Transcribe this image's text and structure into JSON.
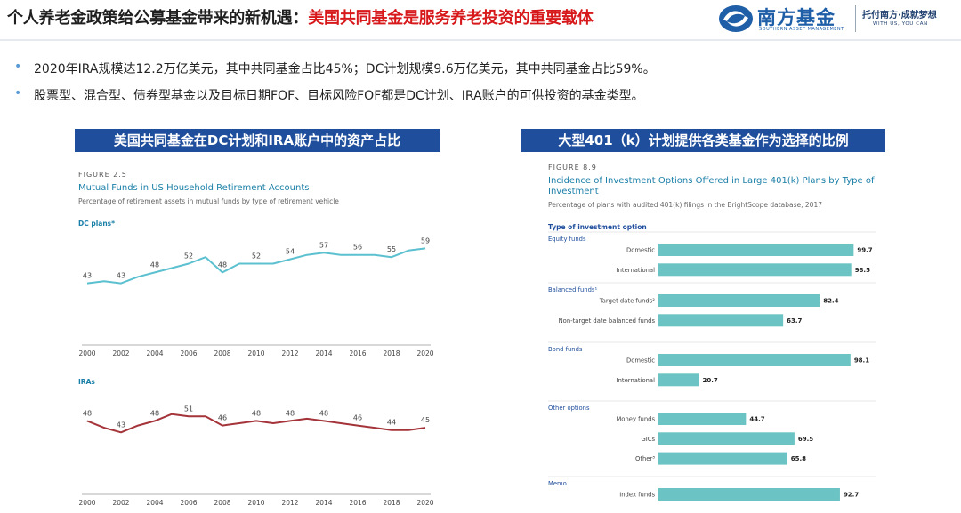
{
  "header": {
    "title_main": "个人养老金政策给公募基金带来的新机遇：",
    "title_highlight": "美国共同基金是服务养老投资的重要载体",
    "logo_cn": "南方基金",
    "logo_en": "SOUTHERN ASSET MANAGEMENT",
    "slogan_cn": "托付南方·成就梦想",
    "slogan_en": "WITH US, YOU CAN"
  },
  "bullets": [
    "2020年IRA规模达12.2万亿美元，其中共同基金占比45%；DC计划规模9.6万亿美元，其中共同基金占比59%。",
    "股票型、混合型、债券型基金以及目标日期FOF、目标风险FOF都是DC计划、IRA账户的可供投资的基金类型。"
  ],
  "colors": {
    "title_highlight": "#d7191c",
    "section_bar": "#1f4e9c",
    "dc_line": "#5bc0cf",
    "ira_line": "#a4343a",
    "bar_fill": "#6cc3c3",
    "figure_title": "#1a7fa8"
  },
  "left_section": {
    "heading": "美国共同基金在DC计划和IRA账户中的资产占比",
    "figure_label": "FIGURE 2.5",
    "figure_title": "Mutual Funds in US Household Retirement Accounts",
    "figure_subtitle": "Percentage of retirement assets in mutual funds by type of retirement vehicle"
  },
  "right_section": {
    "heading": "大型401（k）计划提供各类基金作为选择的比例",
    "figure_label": "FIGURE 8.9",
    "figure_title": "Incidence of Investment Options Offered in Large 401(k) Plans by Type of Investment",
    "figure_subtitle": "Percentage of plans with audited 401(k) filings in the BrightScope database, 2017",
    "type_header": "Type of investment option"
  },
  "chart_data": [
    {
      "type": "line",
      "title": "DC plans*",
      "x": [
        2000,
        2001,
        2002,
        2003,
        2004,
        2005,
        2006,
        2007,
        2008,
        2009,
        2010,
        2011,
        2012,
        2013,
        2014,
        2015,
        2016,
        2017,
        2018,
        2019,
        2020
      ],
      "values": [
        43,
        44,
        43,
        46,
        48,
        50,
        52,
        55,
        48,
        52,
        52,
        52,
        54,
        56,
        57,
        56,
        56,
        56,
        55,
        58,
        59
      ],
      "data_labels": [
        {
          "x": 2000,
          "label": "43"
        },
        {
          "x": 2002,
          "label": "43"
        },
        {
          "x": 2004,
          "label": "48"
        },
        {
          "x": 2006,
          "label": "52"
        },
        {
          "x": 2008,
          "label": "48"
        },
        {
          "x": 2010,
          "label": "52"
        },
        {
          "x": 2012,
          "label": "54"
        },
        {
          "x": 2014,
          "label": "57"
        },
        {
          "x": 2016,
          "label": "56"
        },
        {
          "x": 2018,
          "label": "55"
        },
        {
          "x": 2020,
          "label": "59"
        }
      ],
      "ticks": [
        "2000",
        "2002",
        "2004",
        "2006",
        "2008",
        "2010",
        "2012",
        "2014",
        "2016",
        "2018",
        "2020"
      ],
      "ylim": [
        40,
        62
      ]
    },
    {
      "type": "line",
      "title": "IRAs",
      "x": [
        2000,
        2001,
        2002,
        2003,
        2004,
        2005,
        2006,
        2007,
        2008,
        2009,
        2010,
        2011,
        2012,
        2013,
        2014,
        2015,
        2016,
        2017,
        2018,
        2019,
        2020
      ],
      "values": [
        48,
        45,
        43,
        46,
        48,
        51,
        50,
        50,
        46,
        47,
        48,
        47,
        48,
        49,
        48,
        47,
        46,
        45,
        44,
        44,
        45
      ],
      "data_labels": [
        {
          "x": 2000,
          "label": "48"
        },
        {
          "x": 2002,
          "label": "43"
        },
        {
          "x": 2004,
          "label": "48"
        },
        {
          "x": 2006,
          "label": "51"
        },
        {
          "x": 2008,
          "label": "46"
        },
        {
          "x": 2010,
          "label": "48"
        },
        {
          "x": 2012,
          "label": "48"
        },
        {
          "x": 2014,
          "label": "48"
        },
        {
          "x": 2016,
          "label": "46"
        },
        {
          "x": 2018,
          "label": "44"
        },
        {
          "x": 2020,
          "label": "45"
        }
      ],
      "ticks": [
        "2000",
        "2002",
        "2004",
        "2006",
        "2008",
        "2010",
        "2012",
        "2014",
        "2016",
        "2018",
        "2020"
      ],
      "ylim": [
        40,
        54
      ]
    },
    {
      "type": "bar",
      "orientation": "horizontal",
      "xlim": [
        0,
        100
      ],
      "groups": [
        {
          "name": "Equity funds",
          "items": [
            {
              "label": "Domestic",
              "value": 99.7
            },
            {
              "label": "International",
              "value": 98.5
            }
          ]
        },
        {
          "name": "Balanced funds¹",
          "items": [
            {
              "label": "Target date funds²",
              "value": 82.4
            },
            {
              "label": "Non-target date balanced funds",
              "value": 63.7
            }
          ]
        },
        {
          "name": "Bond funds",
          "items": [
            {
              "label": "Domestic",
              "value": 98.1
            },
            {
              "label": "International",
              "value": 20.7
            }
          ]
        },
        {
          "name": "Other options",
          "items": [
            {
              "label": "Money funds",
              "value": 44.7
            },
            {
              "label": "GICs",
              "value": 69.5
            },
            {
              "label": "Other³",
              "value": 65.8
            }
          ]
        },
        {
          "name": "Memo",
          "items": [
            {
              "label": "Index funds",
              "value": 92.7
            }
          ]
        }
      ]
    }
  ]
}
